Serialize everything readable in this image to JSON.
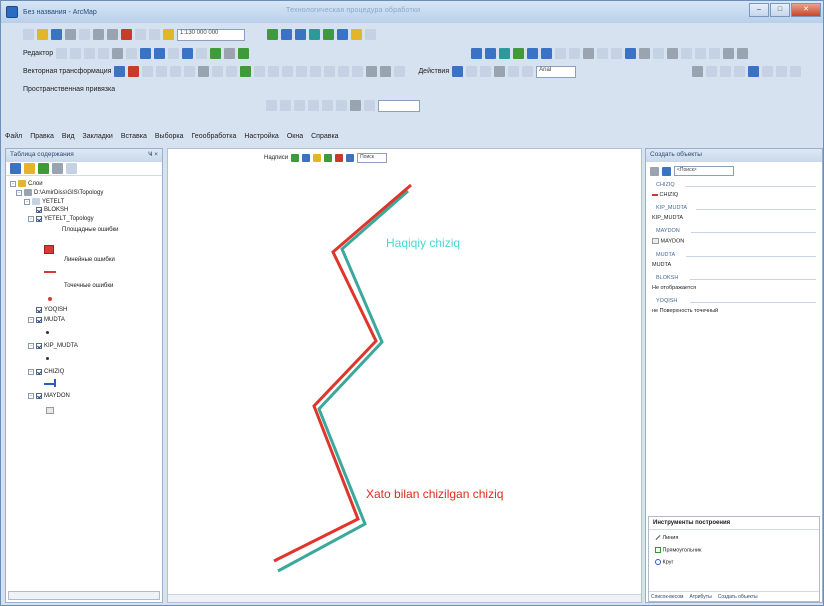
{
  "window": {
    "title": "Без названия - ArcMap",
    "center_title": "Технологическая процедура обработки",
    "min": "–",
    "max": "□",
    "close": "✕"
  },
  "toolbar1": {
    "scale": "1:130 000 000"
  },
  "toolbar3": {
    "georef_label": "Векторная трансформация",
    "actions_label": "Действия",
    "font": "Arial"
  },
  "toolbar2": {
    "edit_label": "Редактор"
  },
  "toolbar4": {
    "space_label": "Пространственная привязка"
  },
  "menu": [
    "Файл",
    "Правка",
    "Вид",
    "Закладки",
    "Вставка",
    "Выборка",
    "Геообработка",
    "Настройка",
    "Окна",
    "Справка"
  ],
  "toc": {
    "title": "Таблица содержания",
    "pin": "Ҹ ×",
    "items": {
      "layers": "Слои",
      "path": "D:\\AmirDiss\\GIS\\Topology",
      "dataset": "YETELT",
      "l_bloksh": "BLOKSH",
      "l_topo": "YETELT_Topology",
      "area_err": "Площадные ошибки",
      "line_err": "Линейные ошибки",
      "point_err": "Точечные ошибки",
      "l_yoqish": "YOQISH",
      "l_mudta": "MUDTA",
      "l_kip": "KIP_MUDTA",
      "l_chiziq": "CHIZIQ",
      "l_maydon": "MAYDON"
    }
  },
  "map_toolbar": {
    "label": "Надписи",
    "search": "Поиск"
  },
  "map_labels": {
    "haqiqiy": "Haqiqiy chiziq",
    "xato": "Xato bilan chizilgan chiziq"
  },
  "right_panel": {
    "title": "Создать объекты",
    "filter": "<Поиск>",
    "sections": [
      {
        "header": "CHIZIQ",
        "item": "CHIZIQ"
      },
      {
        "header": "KIP_MUDTA",
        "item": "KIP_MUDTA"
      },
      {
        "header": "MAYDON",
        "item": "MAYDON"
      },
      {
        "header": "MUDTA",
        "item": "MUDTA"
      },
      {
        "header": "BLOKSH",
        "item": "Не отображается"
      },
      {
        "header": "YOQISH",
        "item": "не Поверхность точечный"
      }
    ],
    "tools_title": "Инструменты построения",
    "tools": [
      "Линия",
      "Прямоугольник",
      "Круг"
    ],
    "footer_left": "Список-весом",
    "footer_mid": "Атрибуты",
    "footer_right": "Создать объекты"
  },
  "colors": {
    "correct_line": "#3aa89a",
    "error_line": "#e0352b",
    "haqiqiy_text": "#4dd6d6",
    "xato_text": "#e02a1f"
  }
}
